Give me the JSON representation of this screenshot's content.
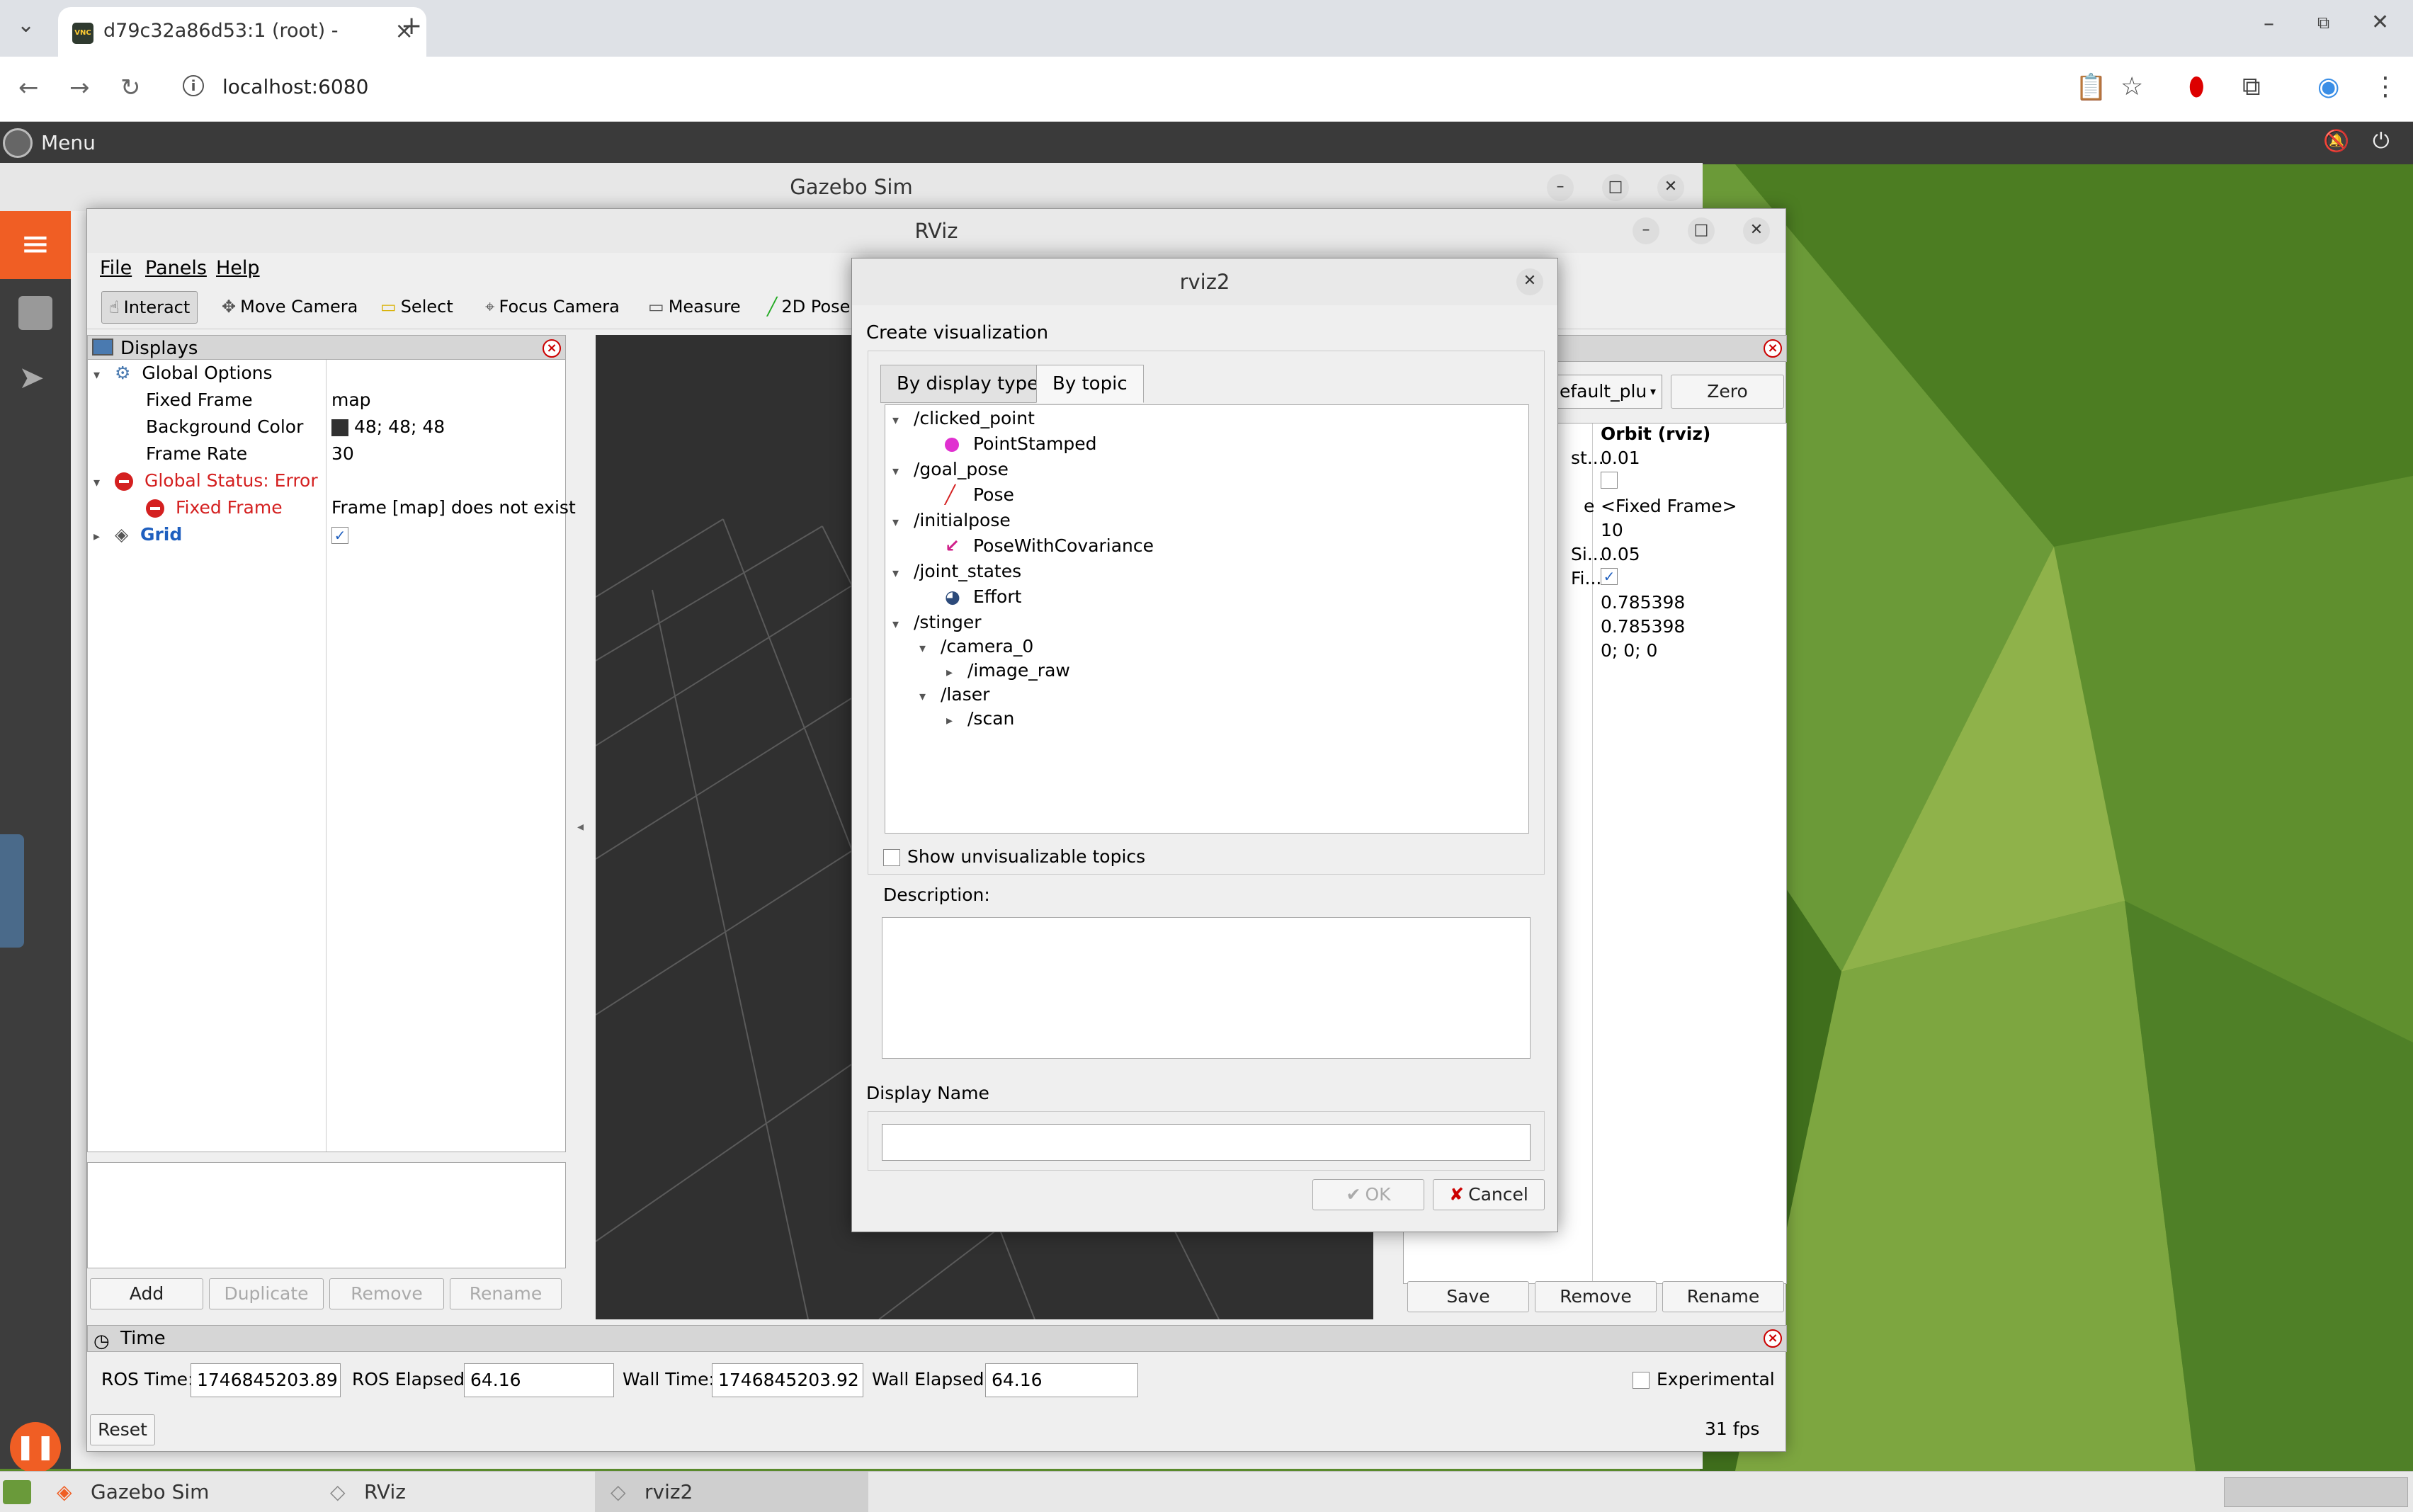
{
  "browser": {
    "tab_title": "d79c32a86d53:1 (root) -",
    "favicon": "VNC",
    "url": "localhost:6080"
  },
  "desktop": {
    "menu_label": "Menu"
  },
  "gazebo": {
    "title": "Gazebo Sim"
  },
  "rviz": {
    "title": "RViz",
    "menu": [
      "File",
      "Panels",
      "Help"
    ],
    "toolbar": [
      "Interact",
      "Move Camera",
      "Select",
      "Focus Camera",
      "Measure",
      "2D Pose"
    ],
    "displays": {
      "title": "Displays",
      "rows": [
        {
          "label": "Global Options",
          "value": ""
        },
        {
          "label": "Fixed Frame",
          "value": "map"
        },
        {
          "label": "Background Color",
          "value": "48; 48; 48"
        },
        {
          "label": "Frame Rate",
          "value": "30"
        },
        {
          "label": "Global Status: Error",
          "value": ""
        },
        {
          "label": "Fixed Frame",
          "value": "Frame [map] does not exist"
        },
        {
          "label": "Grid",
          "value": "✓"
        }
      ],
      "buttons": [
        "Add",
        "Duplicate",
        "Remove",
        "Rename"
      ]
    },
    "views": {
      "combo": "efault_plu",
      "zero_label": "Zero",
      "type_value": "Orbit (rviz)",
      "labels": [
        "st...",
        "e",
        "Si...",
        "Fi..."
      ],
      "values": [
        "0.01",
        "",
        "<Fixed Frame>",
        "10",
        "0.05",
        "✓",
        "0.785398",
        "0.785398",
        "0; 0; 0"
      ],
      "buttons": [
        "Save",
        "Remove",
        "Rename"
      ]
    },
    "time": {
      "title": "Time",
      "ros_time_label": "ROS Time:",
      "ros_time": "1746845203.89",
      "ros_elapsed_label": "ROS Elapsed:",
      "ros_elapsed": "64.16",
      "wall_time_label": "Wall Time:",
      "wall_time": "1746845203.92",
      "wall_elapsed_label": "Wall Elapsed:",
      "wall_elapsed": "64.16",
      "experimental_label": "Experimental",
      "reset_label": "Reset",
      "fps": "31 fps"
    }
  },
  "dialog": {
    "title": "rviz2",
    "heading": "Create visualization",
    "tabs": [
      "By display type",
      "By topic"
    ],
    "tree": [
      {
        "label": "/clicked_point",
        "depth": 0,
        "arrow": "▾"
      },
      {
        "label": "PointStamped",
        "depth": 1,
        "icon": "point-stamped-icon"
      },
      {
        "label": "/goal_pose",
        "depth": 0,
        "arrow": "▾"
      },
      {
        "label": "Pose",
        "depth": 1,
        "icon": "pose-icon"
      },
      {
        "label": "/initialpose",
        "depth": 0,
        "arrow": "▾"
      },
      {
        "label": "PoseWithCovariance",
        "depth": 1,
        "icon": "pose-covariance-icon"
      },
      {
        "label": "/joint_states",
        "depth": 0,
        "arrow": "▾"
      },
      {
        "label": "Effort",
        "depth": 1,
        "icon": "effort-icon"
      },
      {
        "label": "/stinger",
        "depth": 0,
        "arrow": "▾"
      },
      {
        "label": "/camera_0",
        "depth": 1,
        "arrow": "▾"
      },
      {
        "label": "/image_raw",
        "depth": 2,
        "arrow": "▸"
      },
      {
        "label": "/laser",
        "depth": 1,
        "arrow": "▾"
      },
      {
        "label": "/scan",
        "depth": 2,
        "arrow": "▸"
      }
    ],
    "show_unvis_label": "Show unvisualizable topics",
    "description_label": "Description:",
    "display_name_label": "Display Name",
    "ok_label": "OK",
    "cancel_label": "Cancel"
  },
  "taskbar": {
    "items": [
      "Gazebo Sim",
      "RViz",
      "rviz2"
    ]
  },
  "colors": {
    "gazebo_accent": "#f05e24",
    "error_red": "#d42020",
    "grid_blue": "#1f5fbf",
    "wallpaper_green": "#5a8a2c",
    "viewport_bg": "#303030"
  }
}
